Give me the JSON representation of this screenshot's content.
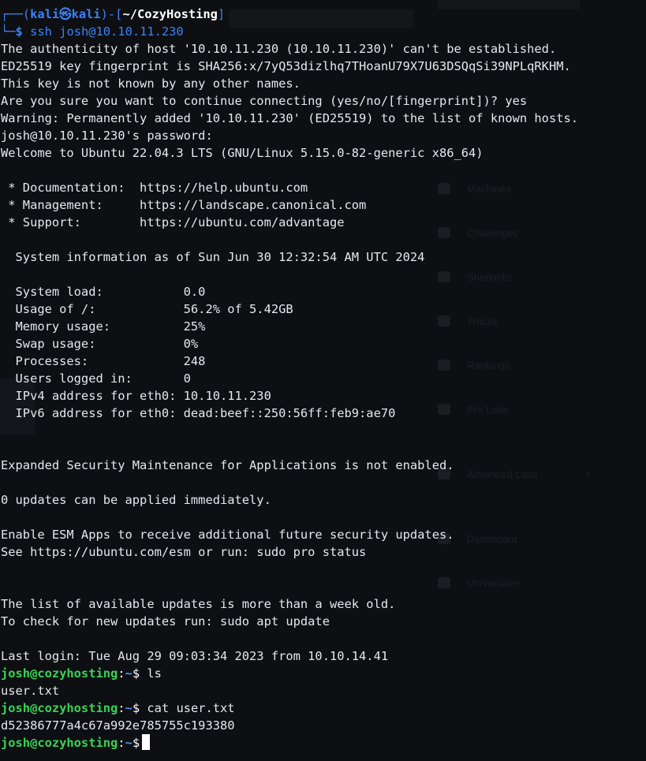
{
  "background_colors": {
    "terminal_bg": "#0e0f13",
    "kali_blue": "#3b82f6",
    "ubuntu_green": "#39d353",
    "text": "#e6e8ee"
  },
  "prompt": {
    "user": "kali",
    "skull": "㉿",
    "host": "kali",
    "cwd": "~/CozyHosting",
    "dollar": "$",
    "command": "ssh josh@10.10.11.230"
  },
  "ssh_output": [
    "The authenticity of host '10.10.11.230 (10.10.11.230)' can't be established.",
    "ED25519 key fingerprint is SHA256:x/7yQ53dizlhq7THoanU79X7U63DSQqSi39NPLqRKHM.",
    "This key is not known by any other names.",
    "Are you sure you want to continue connecting (yes/no/[fingerprint])? yes",
    "Warning: Permanently added '10.10.11.230' (ED25519) to the list of known hosts.",
    "josh@10.10.11.230's password:",
    "Welcome to Ubuntu 22.04.3 LTS (GNU/Linux 5.15.0-82-generic x86_64)"
  ],
  "links": [
    " * Documentation:  https://help.ubuntu.com",
    " * Management:     https://landscape.canonical.com",
    " * Support:        https://ubuntu.com/advantage"
  ],
  "sysinfo_header": "  System information as of Sun Jun 30 12:32:54 AM UTC 2024",
  "sysinfo": [
    "  System load:           0.0",
    "  Usage of /:            56.2% of 5.42GB",
    "  Memory usage:          25%",
    "  Swap usage:            0%",
    "  Processes:             248",
    "  Users logged in:       0",
    "  IPv4 address for eth0: 10.10.11.230",
    "  IPv6 address for eth0: dead:beef::250:56ff:feb9:ae70"
  ],
  "esm_notice": "Expanded Security Maintenance for Applications is not enabled.",
  "updates_notice": "0 updates can be applied immediately.",
  "esm_enable": [
    "Enable ESM Apps to receive additional future security updates.",
    "See https://ubuntu.com/esm or run: sudo pro status"
  ],
  "stale_notice": [
    "The list of available updates is more than a week old.",
    "To check for new updates run: sudo apt update"
  ],
  "last_login": "Last login: Tue Aug 29 09:03:34 2023 from 10.10.14.41",
  "remote_prompt": {
    "user_host": "josh@cozyhosting",
    "sep": ":",
    "path": "~",
    "dollar": "$"
  },
  "session": {
    "cmd1": " ls",
    "out1": "user.txt",
    "cmd2": " cat user.txt",
    "out2": "d52386777a4c67a992e785755c193380"
  },
  "ghost_menu": [
    "Machines",
    "Challenges",
    "Sherlocks",
    "Tracks",
    "Rankings",
    "Pro Labs",
    "Advanced Labs",
    "Dashboard",
    "Universities"
  ]
}
